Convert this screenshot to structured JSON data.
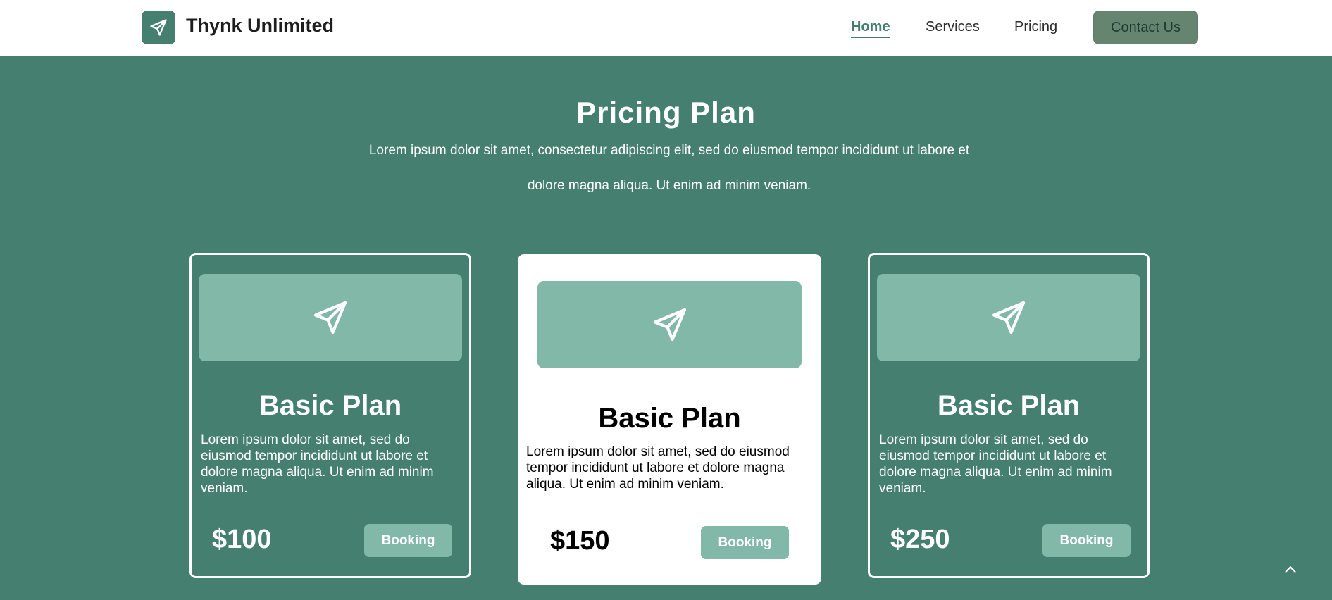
{
  "nav": {
    "brand": "Thynk Unlimited",
    "logo_icon": "paper-plane-icon",
    "links": [
      "Home",
      "Services",
      "Pricing"
    ],
    "active": "Home",
    "contact_label": "Contact Us"
  },
  "hero": {
    "title": "Pricing Plan",
    "subtitle": "Lorem ipsum dolor sit amet, consectetur adipiscing elit, sed do eiusmod tempor incididunt ut labore et dolore magna aliqua. Ut enim ad minim veniam."
  },
  "plans": [
    {
      "icon": "paper-plane-icon",
      "title": "Basic Plan",
      "description": "Lorem ipsum dolor sit amet, sed do eiusmod tempor incididunt ut labore et dolore magna aliqua. Ut enim ad minim veniam.",
      "price": "$100",
      "button": "Booking"
    },
    {
      "icon": "paper-plane-icon",
      "title": "Basic Plan",
      "description": "Lorem ipsum dolor sit amet, sed do eiusmod tempor incididunt ut labore et dolore magna aliqua. Ut enim ad minim veniam.",
      "price": "$150",
      "button": "Booking"
    },
    {
      "icon": "paper-plane-icon",
      "title": "Basic Plan",
      "description": "Lorem ipsum dolor sit amet, sed do eiusmod tempor incididunt ut labore et dolore magna aliqua. Ut enim ad minim veniam.",
      "price": "$250",
      "button": "Booking"
    }
  ],
  "scroll_top_icon": "chevron-up-icon",
  "colors": {
    "primary": "#457f70",
    "accent": "#81b8a8",
    "contact_button": "#668571"
  }
}
